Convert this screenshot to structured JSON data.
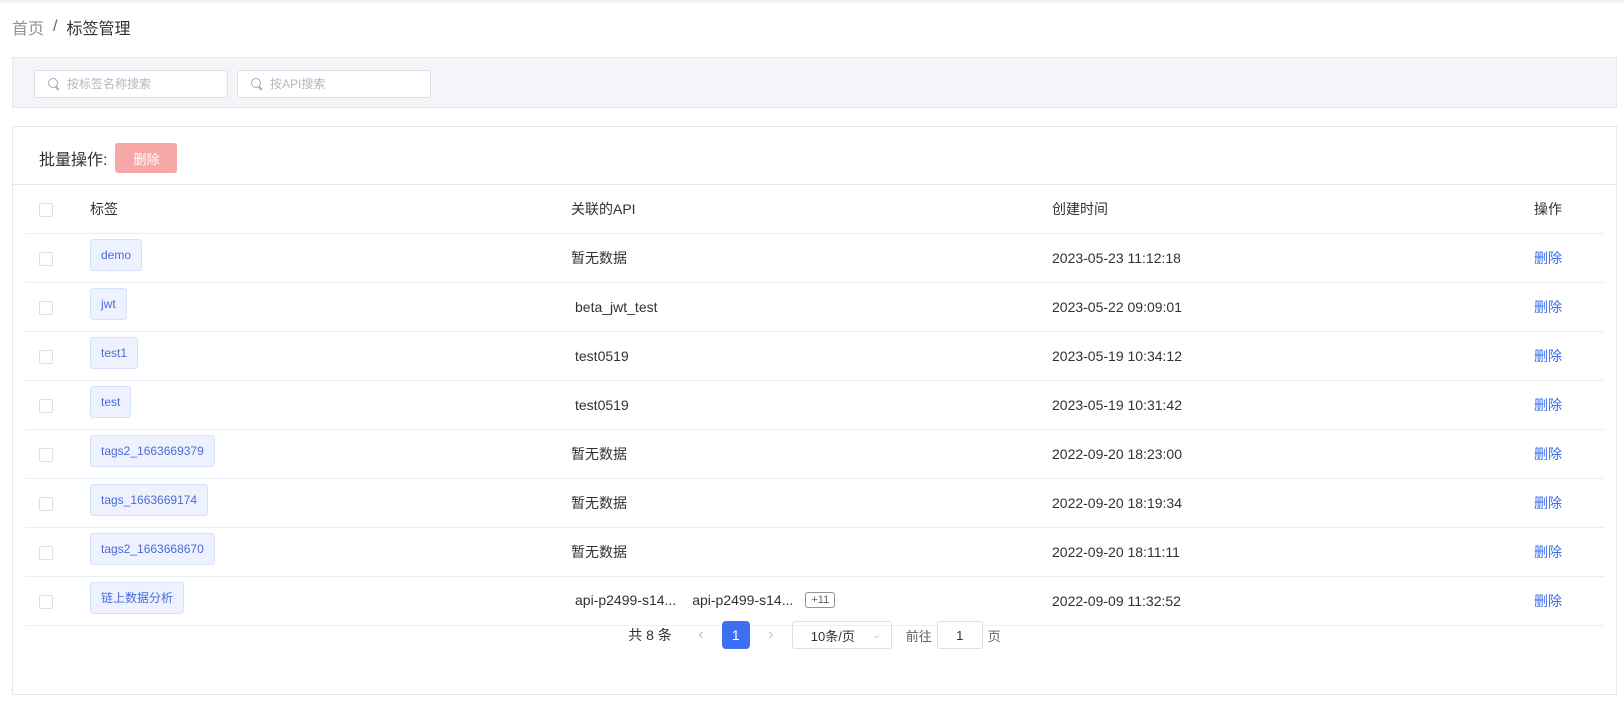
{
  "breadcrumb": {
    "home": "首页",
    "separator": "/",
    "current": "标签管理"
  },
  "search": {
    "tag_placeholder": "按标签名称搜索",
    "api_placeholder": "按API搜索"
  },
  "batch": {
    "label": "批量操作:",
    "delete_label": "删除"
  },
  "table": {
    "headers": {
      "tag": "标签",
      "api": "关联的API",
      "created": "创建时间",
      "action": "操作"
    },
    "rows": [
      {
        "tag": "demo",
        "api": "暂无数据",
        "created": "2023-05-23 11:12:18",
        "action": "删除"
      },
      {
        "tag": "jwt",
        "api": "beta_jwt_test",
        "created": "2023-05-22 09:09:01",
        "action": "删除"
      },
      {
        "tag": "test1",
        "api": "test0519",
        "created": "2023-05-19 10:34:12",
        "action": "删除"
      },
      {
        "tag": "test",
        "api": "test0519",
        "created": "2023-05-19 10:31:42",
        "action": "删除"
      },
      {
        "tag": "tags2_1663669379",
        "api": "暂无数据",
        "created": "2022-09-20 18:23:00",
        "action": "删除"
      },
      {
        "tag": "tags_1663669174",
        "api": "暂无数据",
        "created": "2022-09-20 18:19:34",
        "action": "删除"
      },
      {
        "tag": "tags2_1663668670",
        "api": "暂无数据",
        "created": "2022-09-20 18:11:11",
        "action": "删除"
      },
      {
        "tag": "链上数据分析",
        "api_1": "api-p2499-s14...",
        "api_2": "api-p2499-s14...",
        "api_more": "+11",
        "created": "2022-09-09 11:32:52",
        "action": "删除"
      }
    ]
  },
  "pagination": {
    "total": "共 8 条",
    "current_page": "1",
    "page_size": "10条/页",
    "goto_label": "前往",
    "goto_value": "1",
    "page_unit": "页"
  },
  "colors": {
    "primary": "#3e6ff3",
    "danger_disabled": "#f8a7a7",
    "tag_bg": "#eef2ff"
  }
}
